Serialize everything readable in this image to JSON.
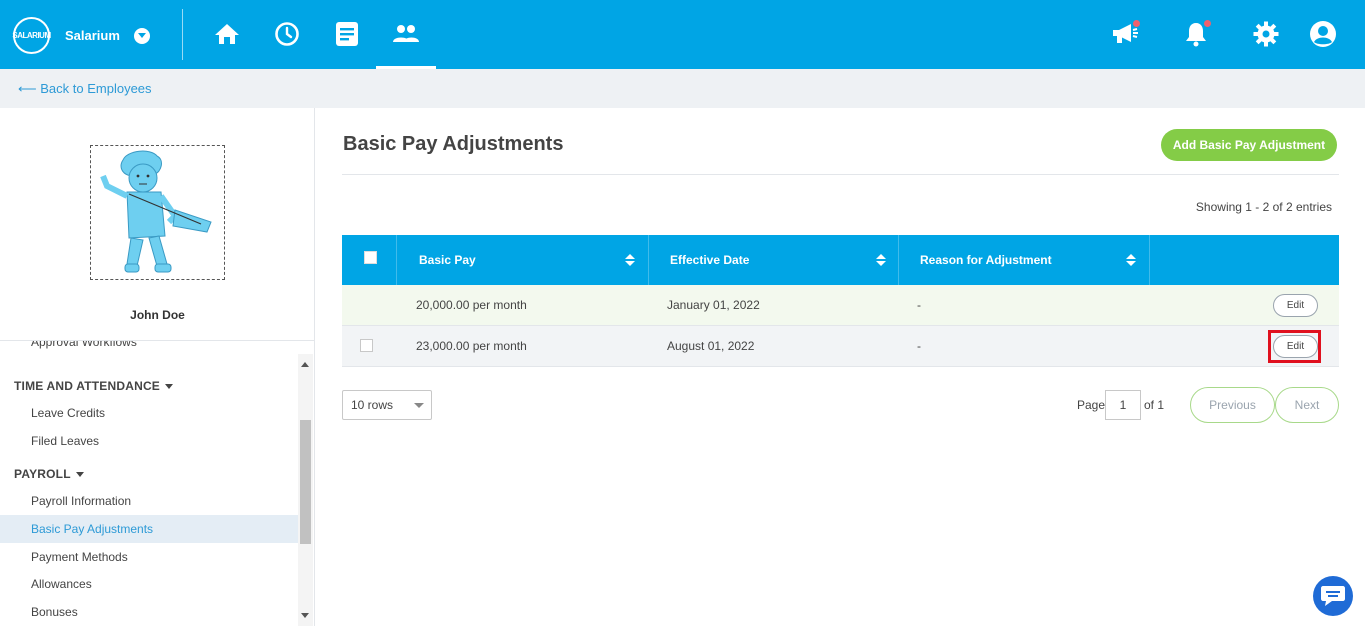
{
  "brand": {
    "logo_text": "SALARIUM",
    "name": "Salarium"
  },
  "nav": {
    "icons": [
      "home-icon",
      "clock-icon",
      "document-icon",
      "people-icon"
    ],
    "active": "people-icon"
  },
  "header_right": [
    "megaphone-icon",
    "bell-icon",
    "gear-icon",
    "user-icon"
  ],
  "back_link": "⟵ Back to Employees",
  "employee": {
    "name": "John Doe"
  },
  "sidebar": {
    "cut_item": "Approval Workflows",
    "sections": [
      {
        "title": "TIME AND ATTENDANCE",
        "items": [
          "Leave Credits",
          "Filed Leaves"
        ]
      },
      {
        "title": "PAYROLL",
        "items": [
          "Payroll Information",
          "Basic Pay Adjustments",
          "Payment Methods",
          "Allowances",
          "Bonuses"
        ]
      }
    ],
    "active_item": "Basic Pay Adjustments"
  },
  "main": {
    "title": "Basic Pay Adjustments",
    "add_button": "Add Basic Pay Adjustment",
    "showing": "Showing 1 - 2 of 2 entries",
    "table": {
      "columns": [
        "Basic Pay",
        "Effective Date",
        "Reason for Adjustment"
      ],
      "rows": [
        {
          "basic_pay": "20,000.00 per month",
          "effective_date": "January 01, 2022",
          "reason": "-",
          "action": "Edit"
        },
        {
          "basic_pay": "23,000.00 per month",
          "effective_date": "August 01, 2022",
          "reason": "-",
          "action": "Edit"
        }
      ]
    },
    "pagination": {
      "rows_per_page": "10 rows",
      "page_label": "Page",
      "page_value": "1",
      "of_label": "of 1",
      "previous": "Previous",
      "next": "Next"
    }
  },
  "colors": {
    "primary": "#00a5e5",
    "accent_green": "#84cc47",
    "highlight_red": "#e0101e",
    "notify_dot": "#f0616d"
  }
}
